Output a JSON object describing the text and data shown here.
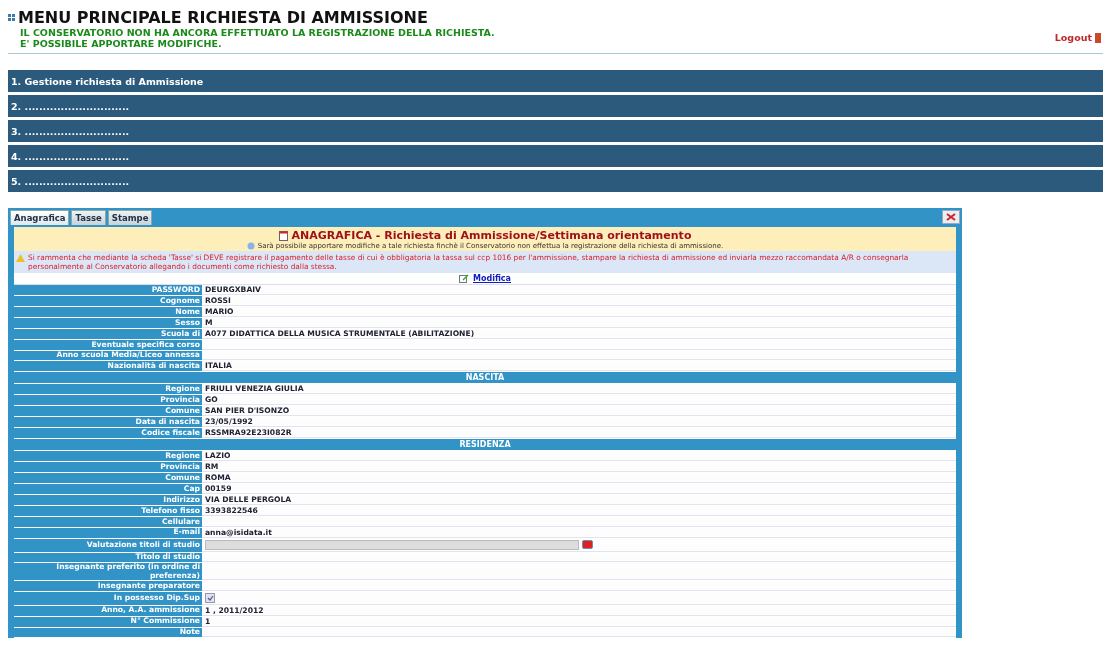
{
  "header": {
    "title": "MENU PRINCIPALE RICHIESTA DI AMMISSIONE",
    "status_lines": [
      "IL CONSERVATORIO NON HA ANCORA EFFETTUATO LA REGISTRAZIONE DELLA RICHIESTA.",
      "E' POSSIBILE APPORTARE MODIFICHE."
    ],
    "logout": "Logout"
  },
  "menu": [
    "1. Gestione richiesta di Ammissione",
    "2. .............................",
    "3. .............................",
    "4. .............................",
    "5. ............................."
  ],
  "tabs": [
    {
      "label": "Anagrafica",
      "selected": true
    },
    {
      "label": "Tasse",
      "selected": false
    },
    {
      "label": "Stampe",
      "selected": false
    }
  ],
  "panel": {
    "title": "ANAGRAFICA - Richiesta di Ammissione/Settimana orientamento",
    "subtitle": "Sarà possibile apportare modifiche a tale richiesta finchè il Conservatorio non effettua la registrazione della richiesta di ammissione.",
    "warning": "Si rammenta che mediante la scheda 'Tasse' si DEVE registrare il pagamento delle tasse di cui è obbligatoria la tassa sul ccp 1016 per l'ammissione, stampare la richiesta di ammissione ed inviarla mezzo raccomandata A/R o consegnarla personalmente al Conservatorio allegando i documenti come richiesto dalla stessa.",
    "edit_link": "Modifica"
  },
  "rows": [
    {
      "kind": "field",
      "label": "PASSWORD",
      "value": "DEURGXBAIV"
    },
    {
      "kind": "field",
      "label": "Cognome",
      "value": "ROSSI"
    },
    {
      "kind": "field",
      "label": "Nome",
      "value": "MARIO"
    },
    {
      "kind": "field",
      "label": "Sesso",
      "value": "M"
    },
    {
      "kind": "field",
      "label": "Scuola di",
      "value": "A077 DIDATTICA DELLA MUSICA STRUMENTALE (ABILITAZIONE)"
    },
    {
      "kind": "field",
      "label": "Eventuale specifica corso"
    },
    {
      "kind": "field",
      "label": "Anno scuola Media/Liceo annessa"
    },
    {
      "kind": "field",
      "label": "Nazionalità di nascita",
      "value": "ITALIA"
    },
    {
      "kind": "section",
      "label": "NASCITA"
    },
    {
      "kind": "field",
      "label": "Regione",
      "value": "FRIULI VENEZIA GIULIA"
    },
    {
      "kind": "field",
      "label": "Provincia",
      "value": "GO"
    },
    {
      "kind": "field",
      "label": "Comune",
      "value": "SAN PIER D'ISONZO"
    },
    {
      "kind": "field",
      "label": "Data di nascita",
      "value": "23/05/1992"
    },
    {
      "kind": "field",
      "label": "Codice fiscale",
      "value": "RSSMRA92E23I082R"
    },
    {
      "kind": "section",
      "label": "RESIDENZA"
    },
    {
      "kind": "field",
      "label": "Regione",
      "value": "LAZIO"
    },
    {
      "kind": "field",
      "label": "Provincia",
      "value": "RM"
    },
    {
      "kind": "field",
      "label": "Comune",
      "value": "ROMA"
    },
    {
      "kind": "field",
      "label": "Cap",
      "value": "00159"
    },
    {
      "kind": "field",
      "label": "Indirizzo",
      "value": "VIA DELLE PERGOLA"
    },
    {
      "kind": "field",
      "label": "Telefono fisso",
      "value": "3393822546"
    },
    {
      "kind": "field",
      "label": "Cellulare"
    },
    {
      "kind": "field",
      "label": "E-mail",
      "value": "anna@isidata.it"
    },
    {
      "kind": "select",
      "label": "Valutazione titoli di studio"
    },
    {
      "kind": "field",
      "label": "Titolo di studio"
    },
    {
      "kind": "field",
      "label": "Insegnante preferito (in ordine di preferenza)"
    },
    {
      "kind": "field",
      "label": "Insegnante preparatore"
    },
    {
      "kind": "checkbox",
      "label": "In possesso Dip.Sup",
      "checked": true
    },
    {
      "kind": "field",
      "label": "Anno, A.A. ammissione",
      "value": "1 , 2011/2012"
    },
    {
      "kind": "field",
      "label": "N° Commissione",
      "value": "1"
    },
    {
      "kind": "field",
      "label": "Note"
    }
  ]
}
